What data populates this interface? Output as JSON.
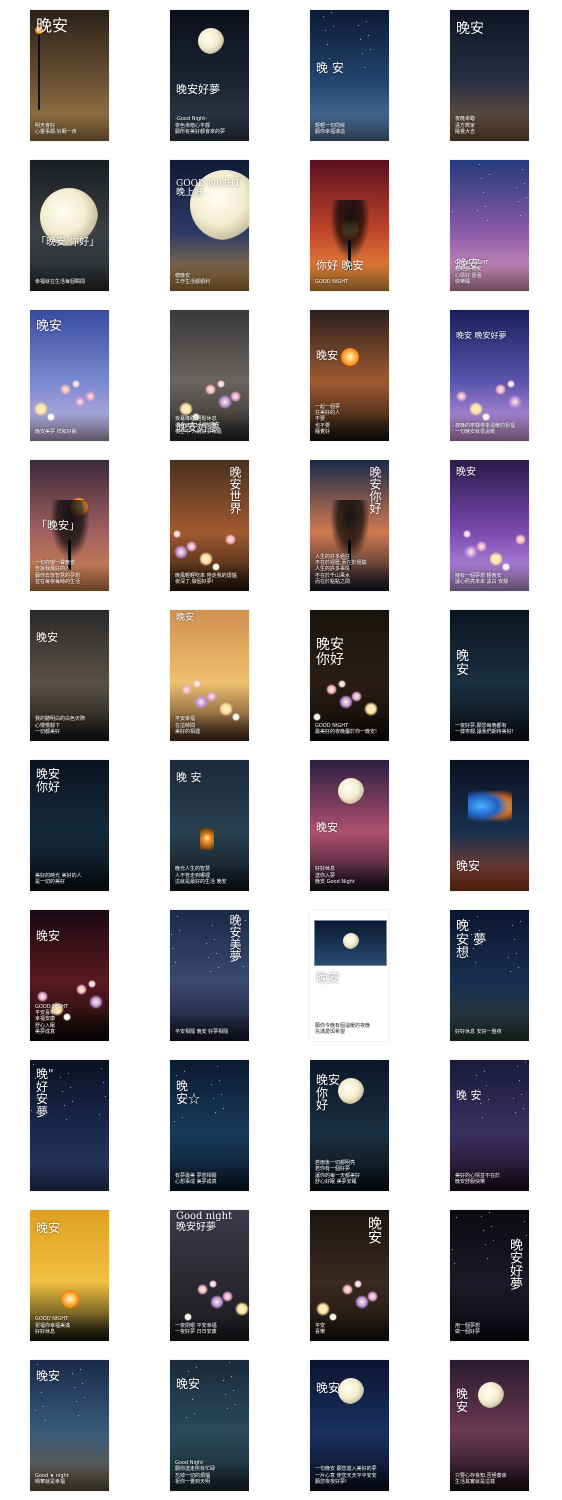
{
  "cards": [
    {
      "title": "晚安",
      "sub": "明天會好\n心靈事靜,好眠一夜",
      "bg": [
        "#2b2218",
        "#6b5236",
        "#a6824c"
      ],
      "deco": "lamp",
      "ttop": 8,
      "tsize": 16
    },
    {
      "title": "晚安好夢",
      "sub": "-Good Night-\n夜色漸暗心平靜\n願所有美好都會來的夢",
      "bg": [
        "#0b0f18",
        "#1c2433",
        "#343d4d"
      ],
      "deco": "moon",
      "ttop": 74,
      "tsize": 11
    },
    {
      "title": "晚 安",
      "sub": "輕輕一句問候\n願你幸福滿溢",
      "bg": [
        "#0d1b33",
        "#24456e",
        "#5c7ea6"
      ],
      "deco": "stars",
      "ttop": 52,
      "tsize": 12
    },
    {
      "title": "晚安",
      "sub": "夜晚來臨\n遠方嚮家\n睡覺大吉",
      "bg": [
        "#0d1424",
        "#2a3044",
        "#7a5a3a"
      ],
      "deco": "road",
      "ttop": 12,
      "tsize": 14
    },
    {
      "title": "「晚安 你好」",
      "sub": "幸福就在生活每個瞬間",
      "bg": [
        "#1a1d20",
        "#3b4046",
        "#2a2d30"
      ],
      "deco": "moon2",
      "ttop": 78,
      "tsize": 10
    },
    {
      "title": "GOOD NIGHT\n晚上好",
      "sub": "德晚安\n工作生活都順利",
      "bg": [
        "#0f1a33",
        "#2c3a66",
        "#b4843c"
      ],
      "deco": "crescent",
      "ttop": 20,
      "tsize": 9
    },
    {
      "title": "你好 晚安",
      "sub": "GOOD NIGHT",
      "bg": [
        "#5a1020",
        "#c2452a",
        "#f2a040"
      ],
      "deco": "tree",
      "ttop": 100,
      "tsize": 11
    },
    {
      "title": "晚安",
      "sub": "GOOD NIGHT\n輕輕放 晚安\n心情好 愿強\n快樂睡",
      "bg": [
        "#243a7a",
        "#8a5aa8",
        "#e4a0c0"
      ],
      "deco": "sea",
      "ttop": 98,
      "tsize": 12
    },
    {
      "title": "晚安",
      "sub": "晚安美夢 祥和好眠",
      "bg": [
        "#3a4aa0",
        "#7a8ad0",
        "#c7b8e0"
      ],
      "deco": "flowers",
      "ttop": 10,
      "tsize": 13
    },
    {
      "title": "晚安好夢",
      "sub": "夜幕降臨 輕鬆休息\n滿身疲憊 心無旁騖\n夜空中 入眠好夢相隨",
      "bg": [
        "#3a3a3a",
        "#6a6460",
        "#2c2a28"
      ],
      "deco": "bouquet",
      "ttop": 112,
      "tsize": 11
    },
    {
      "title": "晚安",
      "sub": "一起一個夢\n在美好的人\n不要\n也不要\n睡覺好",
      "bg": [
        "#2a2020",
        "#a05a30",
        "#1a1410"
      ],
      "deco": "sunset",
      "ttop": 40,
      "tsize": 11
    },
    {
      "title": "晚安 晚安好夢",
      "sub": "夜晚的寧靜帶來溫暖的祝福\n一句晚安就很溫暖",
      "bg": [
        "#1a1f5a",
        "#5a55b0",
        "#d8a0e0"
      ],
      "deco": "flowers2",
      "ttop": 22,
      "tsize": 8
    },
    {
      "title": "「晚安」",
      "sub": "一句你望一聲晚安\n告訴我最好的人\n願你去放智慧的夢想\n並在每夜每時的生活",
      "bg": [
        "#3a2a3a",
        "#a06060",
        "#d88a50"
      ],
      "deco": "branch",
      "ttop": 60,
      "tsize": 11
    },
    {
      "title": "晚安世界",
      "sub": "晚風輕輕吹來 帶走我的煩惱\n夜深了,做個好夢!",
      "bg": [
        "#4a3020",
        "#a05a30",
        "#2a1a10"
      ],
      "deco": "field",
      "ttop": 6,
      "tsize": 12,
      "vertical": true
    },
    {
      "title": "晚安你好",
      "sub": "人生的許多過往\n不在於經歷,而在於經驗\n人生的許多事情\n不在於千山萬水\n而在於點點之間",
      "bg": [
        "#1a2a4a",
        "#d07a50",
        "#1a1a28"
      ],
      "deco": "tree2",
      "ttop": 6,
      "tsize": 12,
      "vertical": true
    },
    {
      "title": "晚安",
      "sub": "擁有一個夢想 輕晚安\n讓心照亮未來 黑白 安靜",
      "bg": [
        "#2a1a4a",
        "#7a4ab0",
        "#c8a0e8"
      ],
      "deco": "flowers3",
      "ttop": 8,
      "tsize": 10
    },
    {
      "title": "晚安",
      "sub": "我的聽明白的白色天際\n心慢慢靜下\n一切都美好",
      "bg": [
        "#2a2a2a",
        "#5a5048",
        "#1a1816"
      ],
      "deco": "house",
      "ttop": 22,
      "tsize": 11
    },
    {
      "title": "晚安",
      "sub": "平安幸福\n在這時間\n美好的相遇",
      "bg": [
        "#d09050",
        "#f0c070",
        "#4a3020"
      ],
      "deco": "blossom",
      "ttop": 4,
      "tsize": 9
    },
    {
      "title": "晚安\n你好",
      "sub": "GOOD NIGHT\n最美好的夜晚屬於你一晚安!",
      "bg": [
        "#1a1410",
        "#2a1e14",
        "#0e0a08"
      ],
      "deco": "flower4",
      "ttop": 28,
      "tsize": 14
    },
    {
      "title": "晚\n安",
      "sub": "一夜好夢,願您每晚都有\n一樣寧靜,讓我們期待美好!",
      "bg": [
        "#0a1420",
        "#1a3040",
        "#0a1018"
      ],
      "deco": "lake",
      "ttop": 40,
      "tsize": 13
    },
    {
      "title": "晚安\n你好",
      "sub": "美好的時光 美好的人\n是一切的美好",
      "bg": [
        "#0a1420",
        "#142a3a",
        "#0a1018"
      ],
      "deco": "plant",
      "ttop": 8,
      "tsize": 12
    },
    {
      "title": "晚 安",
      "sub": "晚光人生的智慧\n人不管走到哪裡\n這就是最好的生活 晚安",
      "bg": [
        "#1a2a3a",
        "#2a4050",
        "#0e1820"
      ],
      "deco": "lantern",
      "ttop": 12,
      "tsize": 11
    },
    {
      "title": "晚安",
      "sub": "好好休息\n送你入夢\n晚安 Good Night",
      "bg": [
        "#2a2040",
        "#b05070",
        "#1a1420"
      ],
      "deco": "moon3",
      "ttop": 62,
      "tsize": 11
    },
    {
      "title": "晚安",
      "sub": "",
      "bg": [
        "#0a1020",
        "#1a3050",
        "#a04020"
      ],
      "deco": "butterfly",
      "ttop": 100,
      "tsize": 12
    },
    {
      "title": "晚安",
      "sub": "GOOD NIGHT\n平安喜樂\n幸福安康\n舒心入眠\n美夢成真",
      "bg": [
        "#1a0a14",
        "#5a1a20",
        "#0a0808"
      ],
      "deco": "lanterns",
      "ttop": 20,
      "tsize": 12
    },
    {
      "title": "晚安美夢",
      "sub": "平安相隨 晚安 好夢相隨",
      "bg": [
        "#1a2a4a",
        "#3a4a70",
        "#1a1a30"
      ],
      "deco": "couple",
      "ttop": 4,
      "tsize": 12,
      "vertical": true
    },
    {
      "title": "晚安",
      "sub": "願你今晚有個溫暖的夜晚\n充滿愛與希望",
      "bg": [
        "#ffffff",
        "#ffffff",
        "#ffffff"
      ],
      "deco": "frame",
      "ttop": 62,
      "tsize": 12
    },
    {
      "title": "晚\n安 夢\n想",
      "sub": "好好休息 安好一整夜",
      "bg": [
        "#0a1630",
        "#1a3050",
        "#2a3a30"
      ],
      "deco": "grass",
      "ttop": 10,
      "tsize": 13
    },
    {
      "title": "晚\"\n好\n安\n夢",
      "sub": "",
      "bg": [
        "#0a1020",
        "#1a2a50",
        "#2a3a60"
      ],
      "deco": "river",
      "ttop": 8,
      "tsize": 12
    },
    {
      "title": "晚\n安☆",
      "sub": "有夢最美 夢想相隨\n心想事成 美夢成真",
      "bg": [
        "#0a1a30",
        "#1a3a5a",
        "#0a1a2a"
      ],
      "deco": "waves",
      "ttop": 20,
      "tsize": 12
    },
    {
      "title": "晚安\n你\n好",
      "sub": "若雨後一切都明亮\n若你有一個好夢\n讓你的每一天都美好\n舒心好眠 美夢安睡",
      "bg": [
        "#0a1828",
        "#1a3040",
        "#0a1016"
      ],
      "deco": "moon4",
      "ttop": 14,
      "tsize": 12
    },
    {
      "title": "晚 安",
      "sub": "美好的心情並不在於\n晚安舒服快樂",
      "bg": [
        "#1a1a3a",
        "#3a3060",
        "#1a1020"
      ],
      "deco": "ferris",
      "ttop": 30,
      "tsize": 11
    },
    {
      "title": "晚安",
      "sub": "GOOD NIGHT\n祝福你幸福美滿\n好好休息",
      "bg": [
        "#e0a020",
        "#f0c040",
        "#1a1a10"
      ],
      "deco": "birds",
      "ttop": 12,
      "tsize": 12
    },
    {
      "title": "Good night\n晚安好夢",
      "sub": "一夜閉眼 平安幸福\n一夜好夢 日日安康",
      "bg": [
        "#3a3a4a",
        "#2a2a30",
        "#1a1a20"
      ],
      "deco": "flowers5",
      "ttop": 2,
      "tsize": 10
    },
    {
      "title": "晚安",
      "sub": "平安\n喜樂",
      "bg": [
        "#1a1410",
        "#3a2a20",
        "#1a1410"
      ],
      "deco": "flower6",
      "ttop": 6,
      "tsize": 14,
      "vertical": true
    },
    {
      "title": "晚安好夢",
      "sub": "用一個夢想\n做一個好夢",
      "bg": [
        "#0a0a10",
        "#1a1a28",
        "#0a0a14"
      ],
      "deco": "night",
      "ttop": 28,
      "tsize": 13,
      "vertical": true
    },
    {
      "title": "晚安",
      "sub": "Good ★ night\n晴華就是幸福",
      "bg": [
        "#1a2a4a",
        "#3a5a7a",
        "#6a5a40"
      ],
      "deco": "child",
      "ttop": 10,
      "tsize": 12
    },
    {
      "title": "晚安",
      "sub": "Good Night\n願你送走所有忙碌\n忘掉一切的煩惱\n祝你一覺到天明",
      "bg": [
        "#1a2a3a",
        "#2a4a5a",
        "#1a2a30"
      ],
      "deco": "spark",
      "ttop": 18,
      "tsize": 12
    },
    {
      "title": "晚安",
      "sub": "一句晚安 願您進入美好的夢\n一片心意 使您天天平平安安\n願您夜夜好夢!",
      "bg": [
        "#0a1430",
        "#1a3060",
        "#0a1020"
      ],
      "deco": "crescent2",
      "ttop": 22,
      "tsize": 12
    },
    {
      "title": "晚\n安",
      "sub": "只要心存良知,否極泰來\n生活其實就是這樣",
      "bg": [
        "#2a1a30",
        "#6a3a50",
        "#1a1018"
      ],
      "deco": "moon5",
      "ttop": 28,
      "tsize": 12
    }
  ]
}
